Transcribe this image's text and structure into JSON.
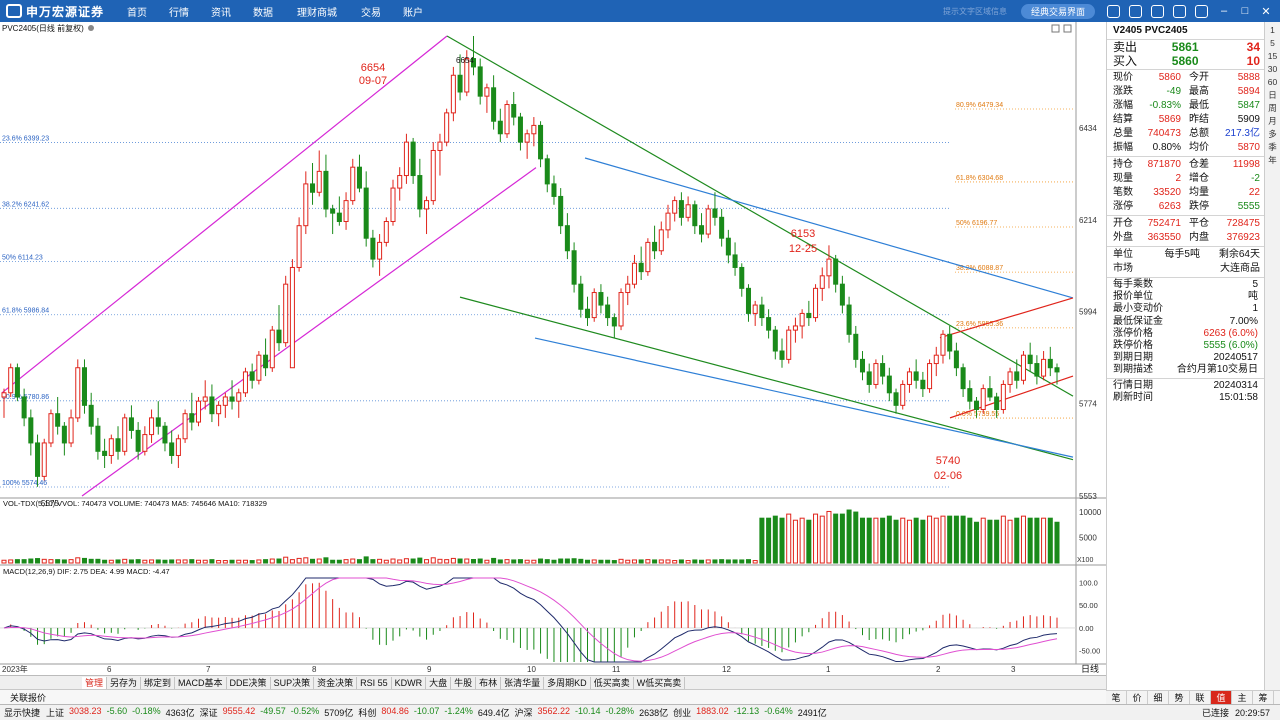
{
  "brand": {
    "name": "申万宏源证券"
  },
  "nav": [
    "首页",
    "行情",
    "资讯",
    "数据",
    "理财商城",
    "交易",
    "账户"
  ],
  "topright": {
    "faint_text": "提示文字区域信息",
    "classic_button": "经典交易界面"
  },
  "chart_header": {
    "symbol": "PVC2405",
    "mode": "(日线 前复权)"
  },
  "chart_data": {
    "type": "candlestick",
    "ylim": [
      5553,
      6654
    ],
    "price_ticks": [
      6434,
      6214,
      5994,
      5774,
      5553
    ],
    "month_labels": [
      "2023年",
      "6",
      "7",
      "8",
      "9",
      "10",
      "11",
      "12",
      "1",
      "2",
      "3"
    ],
    "candles": [
      [
        5790,
        5810,
        5740,
        5800
      ],
      [
        5800,
        5870,
        5790,
        5860
      ],
      [
        5860,
        5870,
        5780,
        5790
      ],
      [
        5790,
        5810,
        5720,
        5740
      ],
      [
        5740,
        5760,
        5650,
        5680
      ],
      [
        5680,
        5700,
        5575,
        5600
      ],
      [
        5600,
        5690,
        5590,
        5680
      ],
      [
        5680,
        5760,
        5670,
        5750
      ],
      [
        5750,
        5790,
        5700,
        5720
      ],
      [
        5720,
        5730,
        5650,
        5680
      ],
      [
        5680,
        5760,
        5670,
        5740
      ],
      [
        5740,
        5880,
        5730,
        5860
      ],
      [
        5860,
        5880,
        5750,
        5770
      ],
      [
        5770,
        5800,
        5700,
        5720
      ],
      [
        5720,
        5740,
        5640,
        5660
      ],
      [
        5660,
        5690,
        5620,
        5650
      ],
      [
        5650,
        5700,
        5630,
        5690
      ],
      [
        5690,
        5720,
        5640,
        5660
      ],
      [
        5660,
        5750,
        5650,
        5740
      ],
      [
        5740,
        5770,
        5690,
        5710
      ],
      [
        5710,
        5730,
        5640,
        5660
      ],
      [
        5660,
        5720,
        5650,
        5700
      ],
      [
        5700,
        5760,
        5680,
        5740
      ],
      [
        5740,
        5780,
        5700,
        5720
      ],
      [
        5720,
        5730,
        5660,
        5680
      ],
      [
        5680,
        5710,
        5630,
        5650
      ],
      [
        5650,
        5700,
        5620,
        5690
      ],
      [
        5690,
        5760,
        5680,
        5750
      ],
      [
        5750,
        5800,
        5710,
        5730
      ],
      [
        5730,
        5790,
        5720,
        5780
      ],
      [
        5780,
        5830,
        5760,
        5790
      ],
      [
        5790,
        5820,
        5730,
        5750
      ],
      [
        5750,
        5780,
        5720,
        5770
      ],
      [
        5770,
        5800,
        5740,
        5790
      ],
      [
        5790,
        5830,
        5760,
        5780
      ],
      [
        5780,
        5810,
        5740,
        5800
      ],
      [
        5800,
        5860,
        5790,
        5850
      ],
      [
        5850,
        5870,
        5810,
        5830
      ],
      [
        5830,
        5900,
        5820,
        5890
      ],
      [
        5890,
        5930,
        5840,
        5860
      ],
      [
        5860,
        5960,
        5850,
        5950
      ],
      [
        5950,
        6010,
        5900,
        5920
      ],
      [
        5920,
        6080,
        5910,
        6060
      ],
      [
        5860,
        6120,
        6030,
        6100
      ],
      [
        6100,
        6220,
        6090,
        6200
      ],
      [
        6200,
        6330,
        6180,
        6300
      ],
      [
        6300,
        6350,
        6250,
        6280
      ],
      [
        6280,
        6380,
        6270,
        6330
      ],
      [
        6330,
        6370,
        6220,
        6240
      ],
      [
        6240,
        6250,
        6180,
        6230
      ],
      [
        6230,
        6270,
        6200,
        6210
      ],
      [
        6210,
        6280,
        6190,
        6260
      ],
      [
        6260,
        6360,
        6250,
        6340
      ],
      [
        6340,
        6370,
        6280,
        6290
      ],
      [
        6290,
        6330,
        6150,
        6170
      ],
      [
        6170,
        6190,
        6100,
        6120
      ],
      [
        6120,
        6180,
        6080,
        6160
      ],
      [
        6160,
        6220,
        6150,
        6210
      ],
      [
        6210,
        6310,
        6200,
        6290
      ],
      [
        6290,
        6340,
        6260,
        6320
      ],
      [
        6320,
        6420,
        6300,
        6400
      ],
      [
        6400,
        6410,
        6300,
        6320
      ],
      [
        6320,
        6360,
        6220,
        6240
      ],
      [
        6240,
        6270,
        6180,
        6260
      ],
      [
        6260,
        6400,
        6250,
        6380
      ],
      [
        6380,
        6420,
        6320,
        6400
      ],
      [
        6400,
        6480,
        6390,
        6470
      ],
      [
        6470,
        6580,
        6450,
        6560
      ],
      [
        6560,
        6610,
        6500,
        6520
      ],
      [
        6520,
        6620,
        6510,
        6600
      ],
      [
        6600,
        6654,
        6560,
        6580
      ],
      [
        6580,
        6600,
        6490,
        6510
      ],
      [
        6510,
        6540,
        6470,
        6530
      ],
      [
        6530,
        6560,
        6430,
        6450
      ],
      [
        6450,
        6480,
        6400,
        6420
      ],
      [
        6420,
        6500,
        6410,
        6490
      ],
      [
        6490,
        6520,
        6440,
        6460
      ],
      [
        6460,
        6470,
        6380,
        6400
      ],
      [
        6400,
        6430,
        6360,
        6420
      ],
      [
        6420,
        6460,
        6390,
        6440
      ],
      [
        6440,
        6450,
        6340,
        6360
      ],
      [
        6360,
        6370,
        6280,
        6300
      ],
      [
        6300,
        6320,
        6250,
        6270
      ],
      [
        6270,
        6290,
        6180,
        6200
      ],
      [
        6200,
        6230,
        6120,
        6140
      ],
      [
        6140,
        6160,
        6040,
        6060
      ],
      [
        6060,
        6080,
        5980,
        6000
      ],
      [
        6000,
        6030,
        5960,
        5980
      ],
      [
        5980,
        6050,
        5970,
        6040
      ],
      [
        6040,
        6060,
        5990,
        6010
      ],
      [
        6010,
        6030,
        5960,
        5980
      ],
      [
        5980,
        5990,
        5930,
        5960
      ],
      [
        5960,
        6050,
        5950,
        6040
      ],
      [
        6040,
        6080,
        6010,
        6060
      ],
      [
        6060,
        6130,
        6050,
        6110
      ],
      [
        6110,
        6150,
        6070,
        6090
      ],
      [
        6090,
        6170,
        6080,
        6160
      ],
      [
        6160,
        6200,
        6120,
        6140
      ],
      [
        6140,
        6210,
        6130,
        6190
      ],
      [
        6190,
        6250,
        6170,
        6230
      ],
      [
        6230,
        6270,
        6210,
        6260
      ],
      [
        6260,
        6280,
        6200,
        6220
      ],
      [
        6220,
        6270,
        6210,
        6250
      ],
      [
        6250,
        6260,
        6180,
        6200
      ],
      [
        6200,
        6230,
        6160,
        6180
      ],
      [
        6180,
        6250,
        6170,
        6240
      ],
      [
        6240,
        6280,
        6200,
        6220
      ],
      [
        6220,
        6240,
        6150,
        6170
      ],
      [
        6170,
        6190,
        6110,
        6130
      ],
      [
        6130,
        6160,
        6080,
        6100
      ],
      [
        6100,
        6110,
        6030,
        6050
      ],
      [
        6050,
        6060,
        5970,
        5990
      ],
      [
        5990,
        6020,
        5960,
        6010
      ],
      [
        6010,
        6030,
        5960,
        5980
      ],
      [
        5980,
        6000,
        5930,
        5950
      ],
      [
        5950,
        5960,
        5880,
        5900
      ],
      [
        5900,
        5930,
        5860,
        5880
      ],
      [
        5880,
        5960,
        5870,
        5950
      ],
      [
        5950,
        5980,
        5920,
        5960
      ],
      [
        5960,
        6000,
        5930,
        5990
      ],
      [
        5990,
        6020,
        5960,
        5980
      ],
      [
        5980,
        6060,
        5970,
        6050
      ],
      [
        6050,
        6100,
        6020,
        6080
      ],
      [
        6080,
        6153,
        6050,
        6120
      ],
      [
        6120,
        6130,
        6040,
        6060
      ],
      [
        6060,
        6080,
        5990,
        6010
      ],
      [
        6010,
        6030,
        5920,
        5940
      ],
      [
        5940,
        5960,
        5860,
        5880
      ],
      [
        5880,
        5900,
        5830,
        5850
      ],
      [
        5850,
        5870,
        5800,
        5820
      ],
      [
        5820,
        5880,
        5810,
        5870
      ],
      [
        5870,
        5890,
        5820,
        5840
      ],
      [
        5840,
        5860,
        5780,
        5800
      ],
      [
        5800,
        5810,
        5750,
        5770
      ],
      [
        5770,
        5830,
        5760,
        5820
      ],
      [
        5820,
        5860,
        5800,
        5850
      ],
      [
        5850,
        5880,
        5810,
        5830
      ],
      [
        5830,
        5850,
        5790,
        5810
      ],
      [
        5810,
        5880,
        5800,
        5870
      ],
      [
        5870,
        5910,
        5840,
        5890
      ],
      [
        5890,
        5950,
        5870,
        5940
      ],
      [
        5940,
        5960,
        5880,
        5900
      ],
      [
        5900,
        5920,
        5840,
        5860
      ],
      [
        5860,
        5870,
        5790,
        5810
      ],
      [
        5810,
        5830,
        5760,
        5780
      ],
      [
        5780,
        5790,
        5740,
        5760
      ],
      [
        5760,
        5820,
        5750,
        5810
      ],
      [
        5810,
        5840,
        5780,
        5790
      ],
      [
        5790,
        5800,
        5740,
        5760
      ],
      [
        5760,
        5830,
        5750,
        5820
      ],
      [
        5820,
        5860,
        5800,
        5850
      ],
      [
        5850,
        5880,
        5810,
        5830
      ],
      [
        5830,
        5900,
        5820,
        5890
      ],
      [
        5890,
        5920,
        5850,
        5870
      ],
      [
        5870,
        5890,
        5820,
        5840
      ],
      [
        5840,
        5900,
        5830,
        5880
      ],
      [
        5880,
        5910,
        5840,
        5860
      ],
      [
        5860,
        5870,
        5820,
        5850
      ]
    ],
    "volume": {
      "label": "VOL-TDX(5,10)",
      "vvol": "VVOL: 740473",
      "volume": "VOLUME: 740473",
      "ma5": "MA5: 745646",
      "ma10": "MA10: 718329",
      "ticks": [
        10000,
        5000
      ],
      "unit": "X100"
    },
    "macd": {
      "label": "MACD(12,26,9)",
      "dif": "DIF: 2.75",
      "dea": "DEA: 4.99",
      "macd": "MACD: -4.47",
      "ticks": [
        "100.0",
        "50.00",
        "0.00",
        "-50.00"
      ]
    },
    "fib_left": [
      {
        "label": "23.6% 6399.23",
        "price": 6399.23
      },
      {
        "label": "38.2% 6241.62",
        "price": 6241.62
      },
      {
        "label": "50% 6114.23",
        "price": 6114.23
      },
      {
        "label": "61.8% 5986.84",
        "price": 5986.84
      },
      {
        "label": "80.9% 5780.86",
        "price": 5780.86
      },
      {
        "label": "100% 5574.46",
        "price": 5574.46
      }
    ],
    "fib_right": [
      {
        "label": "80.9% 6479.34",
        "price": 6479.34
      },
      {
        "label": "61.8% 6304.68",
        "price": 6304.68
      },
      {
        "label": "50% 6196.77",
        "price": 6196.77
      },
      {
        "label": "38.2% 6088.87",
        "price": 6088.87
      },
      {
        "label": "23.6% 5955.36",
        "price": 5955.36
      },
      {
        "label": "0.0% 5739.55",
        "price": 5739.55
      }
    ],
    "annotations": [
      {
        "text": "6654",
        "text2": "09-07",
        "color": "#e0241b"
      },
      {
        "text": "6153",
        "text2": "12-25",
        "color": "#e0241b"
      },
      {
        "text": "5740",
        "text2": "02-06",
        "color": "#e0241b"
      },
      {
        "text": "6654",
        "text2": "",
        "color": "#111111"
      },
      {
        "text": "5575",
        "text2": "",
        "color": "#111111"
      }
    ]
  },
  "quote": {
    "title": "V2405 PVC2405",
    "ask": {
      "label": "卖出",
      "price": "5861",
      "qty": "34"
    },
    "bid": {
      "label": "买入",
      "price": "5860",
      "qty": "10"
    },
    "rows1": [
      {
        "l1": "现价",
        "v1": "5860",
        "c1": "red",
        "l2": "今开",
        "v2": "5888",
        "c2": "red"
      },
      {
        "l1": "涨跌",
        "v1": "-49",
        "c1": "green",
        "l2": "最高",
        "v2": "5894",
        "c2": "red"
      },
      {
        "l1": "涨幅",
        "v1": "-0.83%",
        "c1": "green",
        "l2": "最低",
        "v2": "5847",
        "c2": "green"
      },
      {
        "l1": "结算",
        "v1": "5869",
        "c1": "red",
        "l2": "昨结",
        "v2": "5909",
        "c2": "dark"
      },
      {
        "l1": "总量",
        "v1": "740473",
        "c1": "red",
        "l2": "总额",
        "v2": "217.3亿",
        "c2": "blue"
      },
      {
        "l1": "振幅",
        "v1": "0.80%",
        "c1": "dark",
        "l2": "均价",
        "v2": "5870",
        "c2": "red"
      }
    ],
    "rows2": [
      {
        "l1": "持仓",
        "v1": "871870",
        "c1": "red",
        "l2": "仓差",
        "v2": "11998",
        "c2": "red"
      },
      {
        "l1": "现量",
        "v1": "2",
        "c1": "red",
        "l2": "增仓",
        "v2": "-2",
        "c2": "green"
      },
      {
        "l1": "笔数",
        "v1": "33520",
        "c1": "red",
        "l2": "均量",
        "v2": "22",
        "c2": "red"
      },
      {
        "l1": "涨停",
        "v1": "6263",
        "c1": "red",
        "l2": "跌停",
        "v2": "5555",
        "c2": "green"
      }
    ],
    "rows3": [
      {
        "l1": "开仓",
        "v1": "752471",
        "c1": "red",
        "l2": "平仓",
        "v2": "728475",
        "c2": "red"
      },
      {
        "l1": "外盘",
        "v1": "363550",
        "c1": "red",
        "l2": "内盘",
        "v2": "376923",
        "c2": "red"
      }
    ],
    "unit": {
      "label": "单位",
      "value": "每手5吨",
      "remain": "剩余64天"
    },
    "market": {
      "label": "市场",
      "value": "大连商品"
    },
    "details": [
      {
        "k": "每手乘数",
        "v": "5",
        "c": "dark"
      },
      {
        "k": "报价单位",
        "v": "吨",
        "c": "dark"
      },
      {
        "k": "最小变动价",
        "v": "1",
        "c": "dark"
      },
      {
        "k": "最低保证金",
        "v": "7.00%",
        "c": "dark"
      },
      {
        "k": "涨停价格",
        "v": "6263 (6.0%)",
        "c": "red"
      },
      {
        "k": "跌停价格",
        "v": "5555 (6.0%)",
        "c": "green"
      },
      {
        "k": "到期日期",
        "v": "20240517",
        "c": "dark"
      },
      {
        "k": "到期描述",
        "v": "合约月第10交易日",
        "c": "dark"
      }
    ],
    "date": [
      {
        "k": "行情日期",
        "v": "20240314",
        "c": "dark"
      },
      {
        "k": "刷新时间",
        "v": "15:01:58",
        "c": "dark"
      }
    ]
  },
  "right_nav": [
    "1",
    "5",
    "15",
    "30",
    "60",
    "日",
    "周",
    "月",
    "多",
    "季",
    "年"
  ],
  "period_label": "日线",
  "tabs": [
    "管理",
    "另存为",
    "绑定到",
    "MACD基本",
    "DDE决策",
    "SUP决策",
    "资金决策",
    "RSI 55",
    "KDWR",
    "大盘",
    "牛股",
    "布林",
    "张清华量",
    "多周期KD",
    "低买高卖",
    "W低买高卖"
  ],
  "related": "关联报价",
  "bottom_tabs": [
    "笔",
    "价",
    "细",
    "势",
    "联",
    "值",
    "主",
    "筹"
  ],
  "status": {
    "fast": "显示快捷",
    "indices": [
      {
        "name": "上证",
        "price": "3038.23",
        "chg": "-5.60",
        "pct": "-0.18%",
        "amt": "4363亿"
      },
      {
        "name": "深证",
        "price": "9555.42",
        "chg": "-49.57",
        "pct": "-0.52%",
        "amt": "5709亿"
      },
      {
        "name": "科创",
        "price": "804.86",
        "chg": "-10.07",
        "pct": "-1.24%",
        "amt": "649.4亿"
      },
      {
        "name": "沪深",
        "price": "3562.22",
        "chg": "-10.14",
        "pct": "-0.28%",
        "amt": "2638亿"
      },
      {
        "name": "创业",
        "price": "1883.02",
        "chg": "-12.13",
        "pct": "-0.64%",
        "amt": "2491亿"
      }
    ],
    "connected": "已连接",
    "clock": "20:29:57"
  }
}
